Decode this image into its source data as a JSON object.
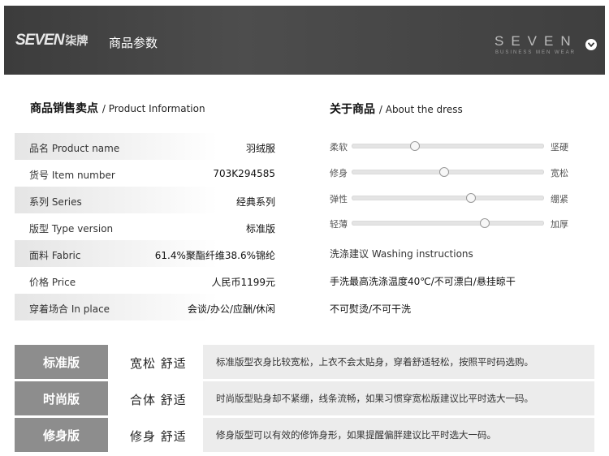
{
  "header": {
    "logo_mark": "SEVEN",
    "logo_cn": "柒牌",
    "title": "商品参数",
    "brand_word": "SEVEN",
    "brand_sub": "BUSINESS MEN WEAR"
  },
  "product_info": {
    "title_cn": "商品销售卖点",
    "title_en": "/ Product Information",
    "rows": [
      {
        "label": "品名 Product name",
        "value": "羽绒服"
      },
      {
        "label": "货号 Item number",
        "value": "703K294585"
      },
      {
        "label": "系列 Series",
        "value": "经典系列"
      },
      {
        "label": "版型 Type version",
        "value": "标准版"
      },
      {
        "label": "面料 Fabric",
        "value": "61.4%聚酯纤维38.6%锦纶"
      },
      {
        "label": "价格 Price",
        "value": "人民币1199元"
      },
      {
        "label": "穿着场合 In place",
        "value": "会谈/办公/应酬/休闲"
      }
    ]
  },
  "about": {
    "title_cn": "关于商品",
    "title_en": "/ About the dress",
    "sliders": [
      {
        "left": "柔软",
        "right": "坚硬",
        "level": 0.33
      },
      {
        "left": "修身",
        "right": "宽松",
        "level": 0.48
      },
      {
        "left": "弹性",
        "right": "绷紧",
        "level": 0.62
      },
      {
        "left": "轻薄",
        "right": "加厚",
        "level": 0.69
      }
    ],
    "washing_title": "洗涤建议  Washing instructions",
    "washing_lines": [
      "手洗最高洗涤温度40℃/不可漂白/悬挂晾干",
      "不可熨烫/不可干洗"
    ]
  },
  "versions": [
    {
      "name": "标准版",
      "feature": "宽松  舒适",
      "desc": "标准版型衣身比较宽松，上衣不会太贴身，穿着舒适轻松，按照平时码选购。"
    },
    {
      "name": "时尚版",
      "feature": "合体  舒适",
      "desc": "时尚版型贴身却不紧绷，线条流畅，如果习惯穿宽松版建议比平时选大一码。"
    },
    {
      "name": "修身版",
      "feature": "修身  舒适",
      "desc": "修身版型可以有效的修饰身形，如果提醒偏胖建议比平时选大一码。"
    }
  ]
}
